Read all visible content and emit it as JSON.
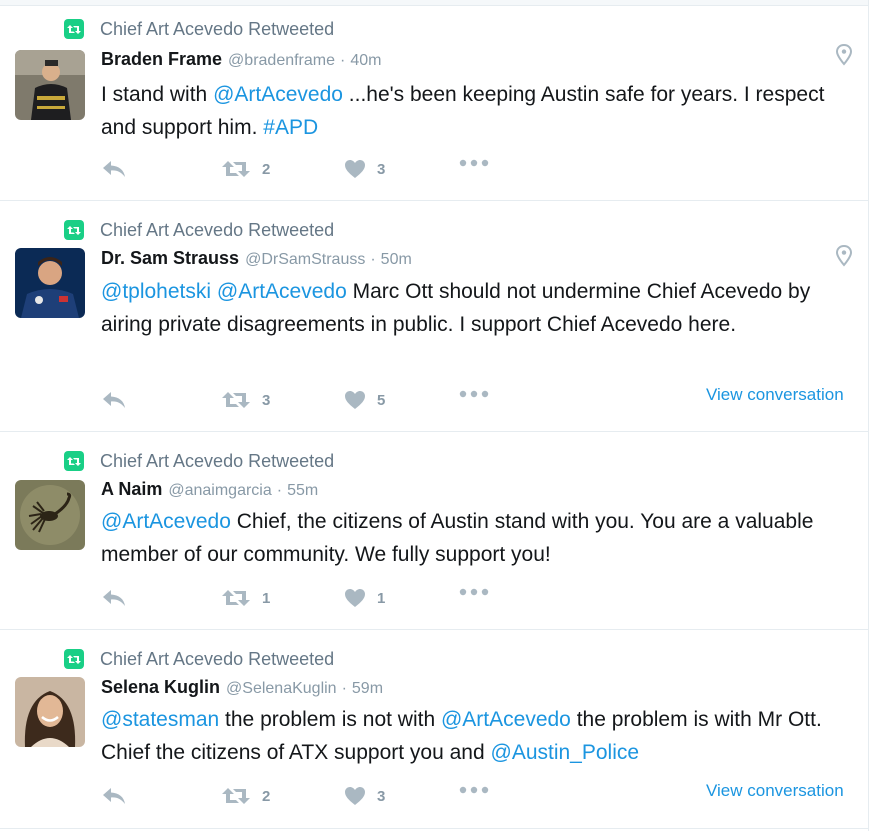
{
  "colors": {
    "link": "#1b95e0",
    "retweet_badge": "#19cf86",
    "muted": "#8899a6"
  },
  "tweets": [
    {
      "retweet_label": "Chief Art Acevedo Retweeted",
      "name": "Braden Frame",
      "handle": "@bradenframe",
      "separator": "·",
      "time": "40m",
      "text": [
        {
          "t": "I stand with "
        },
        {
          "t": "@ArtAcevedo",
          "link": true
        },
        {
          "t": " ...he's been keeping Austin safe for years. I respect and support him. "
        },
        {
          "t": "#APD",
          "link": true
        }
      ],
      "retweets": "2",
      "likes": "3",
      "view_conversation": ""
    },
    {
      "retweet_label": "Chief Art Acevedo Retweeted",
      "name": "Dr. Sam Strauss",
      "handle": "@DrSamStrauss",
      "separator": "·",
      "time": "50m",
      "text": [
        {
          "t": "@tplohetski",
          "link": true
        },
        {
          "t": " "
        },
        {
          "t": "@ArtAcevedo",
          "link": true
        },
        {
          "t": " Marc Ott should not undermine Chief Acevedo by airing private disagreements in public. I support Chief Acevedo here."
        }
      ],
      "retweets": "3",
      "likes": "5",
      "view_conversation": "View conversation"
    },
    {
      "retweet_label": "Chief Art Acevedo Retweeted",
      "name": "A Naim",
      "handle": "@anaimgarcia",
      "separator": "·",
      "time": "55m",
      "text": [
        {
          "t": "@ArtAcevedo",
          "link": true
        },
        {
          "t": " Chief, the citizens of Austin stand with you. You are a valuable member of our community. We fully support you!"
        }
      ],
      "retweets": "1",
      "likes": "1",
      "view_conversation": ""
    },
    {
      "retweet_label": "Chief Art Acevedo Retweeted",
      "name": "Selena Kuglin",
      "handle": "@SelenaKuglin",
      "separator": "·",
      "time": "59m",
      "text": [
        {
          "t": "@statesman",
          "link": true
        },
        {
          "t": " the problem is not with "
        },
        {
          "t": "@ArtAcevedo",
          "link": true
        },
        {
          "t": " the problem is with Mr Ott. Chief the citizens of ATX support you and "
        },
        {
          "t": "@Austin_Police",
          "link": true
        }
      ],
      "retweets": "2",
      "likes": "3",
      "view_conversation": "View conversation"
    }
  ]
}
